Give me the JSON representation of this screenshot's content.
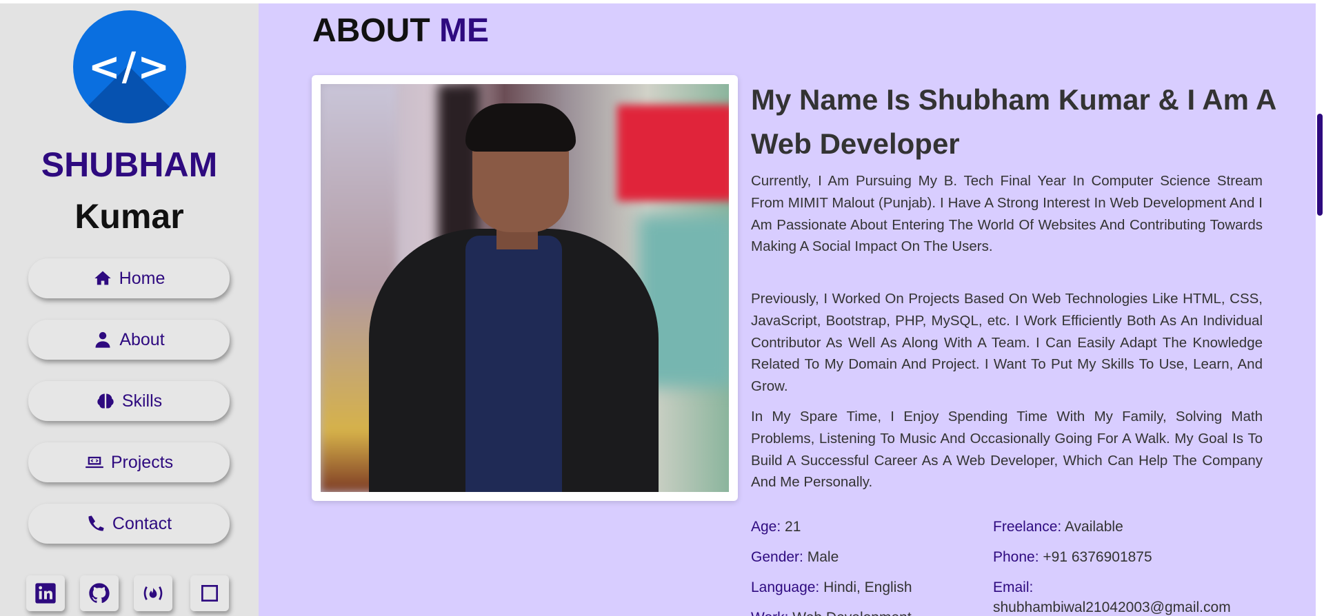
{
  "sidebar": {
    "logo_text": "</>",
    "name_first": "SHUBHAM",
    "name_last": "Kumar",
    "nav": [
      {
        "label": "Home",
        "icon": "home-icon"
      },
      {
        "label": "About",
        "icon": "user-icon"
      },
      {
        "label": "Skills",
        "icon": "brain-icon"
      },
      {
        "label": "Projects",
        "icon": "laptop-code-icon"
      },
      {
        "label": "Contact",
        "icon": "phone-icon"
      }
    ],
    "social": [
      "linkedin-icon",
      "github-icon",
      "freecodecamp-icon",
      "square-icon"
    ]
  },
  "main": {
    "title_plain": "ABOUT",
    "title_highlight": "ME",
    "headline": "My Name Is Shubham Kumar & I Am A Web Developer",
    "paragraphs": [
      "Currently, I Am Pursuing My B. Tech Final Year In Computer Science Stream From MIMIT Malout (Punjab). I Have A Strong Interest In Web Development And I Am Passionate About Entering The World Of Websites And Contributing Towards Making A Social Impact On The Users.",
      "Previously, I Worked On Projects Based On Web Technologies Like HTML, CSS, JavaScript, Bootstrap, PHP, MySQL, etc. I Work Efficiently Both As An Individual Contributor As Well As Along With A Team. I Can Easily Adapt The Knowledge Related To My Domain And Project. I Want To Put My Skills To Use, Learn, And Grow.",
      "In My Spare Time, I Enjoy Spending Time With My Family, Solving Math Problems, Listening To Music And Occasionally Going For A Walk. My Goal Is To Build A Successful Career As A Web Developer, Which Can Help The Company And Me Personally."
    ],
    "info": {
      "age_label": "Age:",
      "age": "21",
      "gender_label": "Gender:",
      "gender": "Male",
      "language_label": "Language:",
      "language": "Hindi, English",
      "work_label": "Work:",
      "work": "Web Development",
      "freelance_label": "Freelance:",
      "freelance": "Available",
      "phone_label": "Phone:",
      "phone": "+91 6376901875",
      "email_label": "Email:",
      "email": "shubhambiwal21042003@gmail.com"
    }
  },
  "colors": {
    "accent": "#2e0a7f",
    "main_bg": "#d8cdff",
    "sidebar_bg": "#e3e3e3",
    "logo_bg": "#0a6fe0"
  }
}
